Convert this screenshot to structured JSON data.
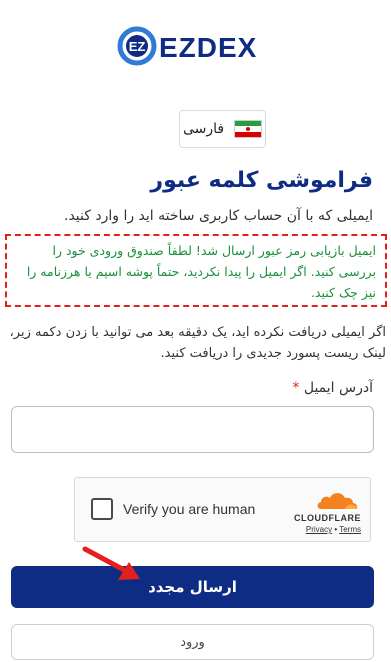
{
  "brand": {
    "name": "EZDEX",
    "primary_color": "#0f2c84",
    "accent_color": "#2f7bd8"
  },
  "language": {
    "label": "فارسی",
    "flag_icon": "iran-flag-icon"
  },
  "page": {
    "title": "فراموشی کلمه عبور",
    "subtitle": "ایمیلی که با آن حساب کاربری ساخته اید را وارد کنید."
  },
  "alert": {
    "text": "ایمیل بازیابی رمز عبور ارسال شد! لطفاً صندوق ورودی خود را بررسی کنید. اگر ایمیل را پیدا نکردید، حتماً پوشه اسپم یا هرزنامه را نیز چک کنید.",
    "color": "#1a8f3a",
    "border_color": "#e3201c"
  },
  "info": {
    "text": "اگر ایمیلی دریافت نکرده اید، یک دقیقه بعد می توانید با زدن دکمه زیر، لینک ریست پسورد جدیدی را دریافت کنید."
  },
  "form": {
    "email_label": "آدرس ایمیل",
    "required_mark": "*",
    "email_value": "",
    "email_placeholder": ""
  },
  "captcha": {
    "label": "Verify you are human",
    "provider": "CLOUDFLARE",
    "privacy": "Privacy",
    "separator": "•",
    "terms": "Terms"
  },
  "buttons": {
    "resend": "ارسال مجدد",
    "login": "ورود"
  }
}
